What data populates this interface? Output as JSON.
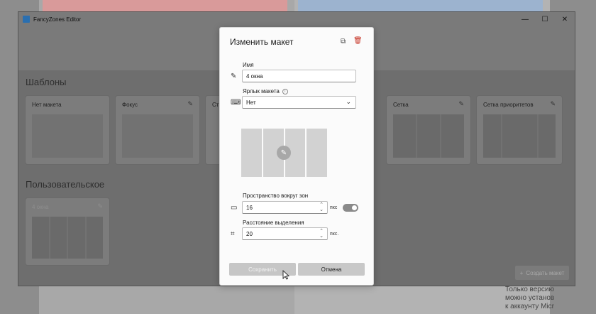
{
  "window": {
    "title": "FancyZones Editor",
    "controls": [
      "—",
      "☐",
      "✕"
    ]
  },
  "templates": {
    "heading": "Шаблоны",
    "cards": [
      {
        "label": "Нет макета",
        "zones": 0,
        "editable": false
      },
      {
        "label": "Фокус",
        "zones": 0,
        "editable": true
      },
      {
        "label": "Ст",
        "zones": 2,
        "editable": false
      },
      {
        "label": "Сетка",
        "zones": 3,
        "editable": true
      },
      {
        "label": "Сетка приоритетов",
        "zones": 3,
        "editable": true
      }
    ]
  },
  "custom": {
    "heading": "Пользовательское",
    "cards": [
      {
        "label": "4 окна",
        "zones": 4
      }
    ],
    "create_label": "Создать макет"
  },
  "dialog": {
    "title": "Изменить макет",
    "name_label": "Имя",
    "name_value": "4 окна",
    "shortcut_label": "Ярлык макета",
    "shortcut_value": "Нет",
    "spacing_label": "Пространство вокруг зон",
    "spacing_value": "16",
    "spacing_unit": "пкс",
    "spacing_enabled": true,
    "distance_label": "Расстояние выделения",
    "distance_value": "20",
    "distance_unit": "пкс.",
    "preview_zones": 4,
    "save_label": "Сохранить",
    "cancel_label": "Отмена"
  },
  "background": {
    "text_lines": [
      "Только версию",
      "можно установ",
      "к аккаунту Micr"
    ]
  },
  "colors": {
    "accent_delete": "#c42b1c",
    "app_icon": "#2a6fb0"
  }
}
